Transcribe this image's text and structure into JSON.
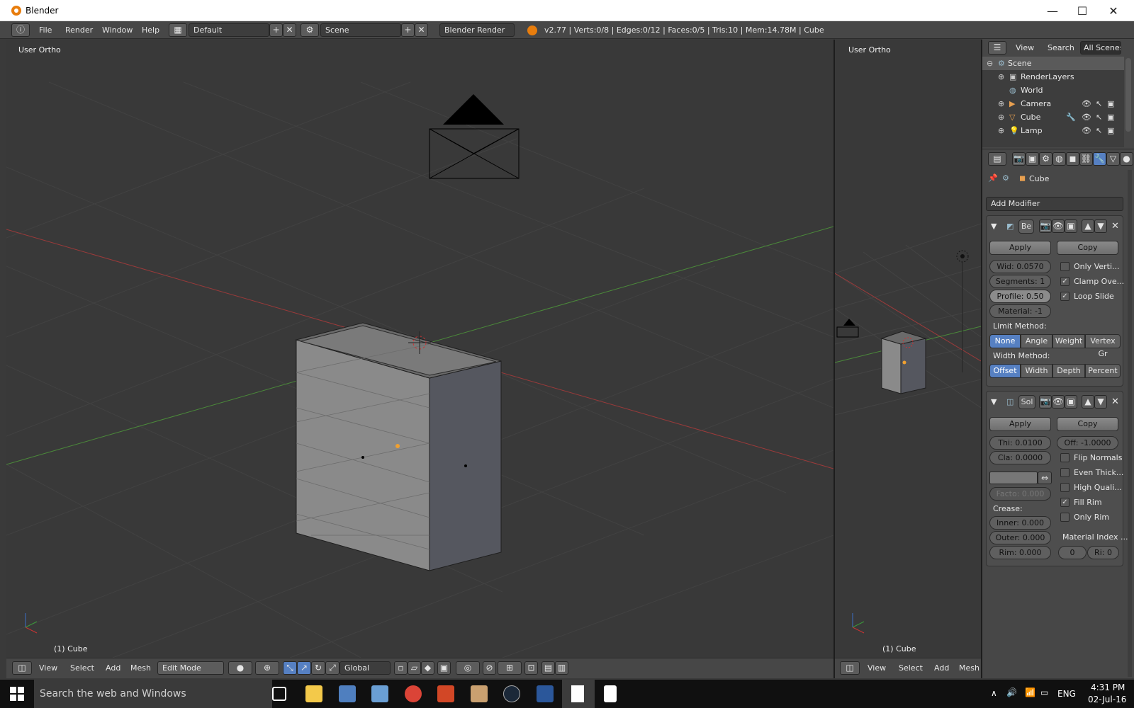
{
  "window": {
    "title": "Blender",
    "minimize": "—",
    "maximize": "☐",
    "close": "✕"
  },
  "infobar": {
    "menus": [
      "File",
      "Render",
      "Window",
      "Help"
    ],
    "screen_layout": "Default",
    "scene": "Scene",
    "render_engine": "Blender Render",
    "stats": "v2.77 | Verts:0/8 | Edges:0/12 | Faces:0/5 | Tris:10 | Mem:14.78M | Cube"
  },
  "viewport_left": {
    "label": "User Ortho",
    "footer": "(1) Cube"
  },
  "viewport_right": {
    "label": "User Ortho",
    "footer": "(1) Cube"
  },
  "bottom_header_left": {
    "menus": [
      "View",
      "Select",
      "Add",
      "Mesh"
    ],
    "mode": "Edit Mode",
    "orientation": "Global"
  },
  "bottom_header_right": {
    "menus": [
      "View",
      "Select",
      "Add",
      "Mesh"
    ]
  },
  "outliner": {
    "tabs": [
      "View",
      "Search",
      "All Scenes"
    ],
    "items": [
      "Scene",
      "RenderLayers",
      "World",
      "Camera",
      "Cube",
      "Lamp"
    ]
  },
  "properties": {
    "context_object": "Cube",
    "add_modifier": "Add Modifier",
    "bevel": {
      "name": "Be",
      "apply": "Apply",
      "copy": "Copy",
      "width": "Wid: 0.0570",
      "segments": "Segments: 1",
      "profile": "Profile:  0.50",
      "material": "Material:  -1",
      "only_vertices": "Only Verti...",
      "clamp_overlap": "Clamp Ove...",
      "loop_slide": "Loop Slide",
      "limit_method_label": "Limit Method:",
      "limit_methods": [
        "None",
        "Angle",
        "Weight",
        "Vertex Gr"
      ],
      "width_method_label": "Width Method:",
      "width_methods": [
        "Offset",
        "Width",
        "Depth",
        "Percent"
      ]
    },
    "solidify": {
      "name": "Sol",
      "apply": "Apply",
      "copy": "Copy",
      "thickness": "Thi:  0.0100",
      "offset": "Off:  -1.0000",
      "clamp": "Cla:  0.0000",
      "flip_normals": "Flip Normals",
      "even_thickness": "Even Thick...",
      "high_quality": "High Quali...",
      "factor": "Facto: 0.000",
      "fill_rim": "Fill Rim",
      "only_rim": "Only Rim",
      "crease_label": "Crease:",
      "inner": "Inner:  0.000",
      "outer": "Outer:  0.000",
      "rim": "Rim:   0.000",
      "material_index_label": "Material Index ...",
      "mat_index": "0",
      "rim_index": "Ri: 0"
    }
  },
  "taskbar": {
    "search_placeholder": "Search the web and Windows",
    "language": "ENG",
    "time": "4:31 PM",
    "date": "02-Jul-16"
  }
}
